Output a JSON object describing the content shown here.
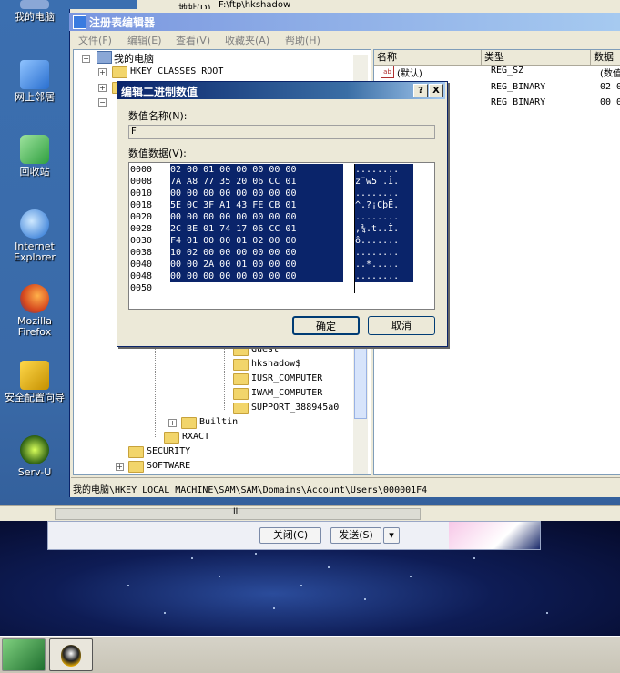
{
  "desktop": {
    "icons": [
      {
        "label": "我的电脑"
      },
      {
        "label": "网上邻居"
      },
      {
        "label": "回收站"
      },
      {
        "label": "Internet Explorer"
      },
      {
        "label": "Mozilla Firefox"
      },
      {
        "label": "安全配置向导"
      },
      {
        "label": "Serv-U"
      }
    ]
  },
  "background_window": {
    "address_label": "地址(D)",
    "address_value": "F:\\ftp\\hkshadow"
  },
  "regedit": {
    "title": "注册表编辑器",
    "menu": [
      "文件(F)",
      "编辑(E)",
      "查看(V)",
      "收藏夹(A)",
      "帮助(H)"
    ],
    "tree": {
      "root": "我的电脑",
      "top_items": [
        "HKEY_CLASSES_ROOT"
      ],
      "sub_items": [
        "Guest",
        "hkshadow$",
        "IUSR_COMPUTER",
        "IWAM_COMPUTER",
        "SUPPORT_388945a0"
      ],
      "builtin": "Builtin",
      "rxact": "RXACT",
      "security": "SECURITY",
      "software": "SOFTWARE"
    },
    "list": {
      "columns": [
        "名称",
        "类型",
        "数据"
      ],
      "rows": [
        {
          "name": "(默认)",
          "type": "REG_SZ",
          "data": "(数值"
        },
        {
          "name": "",
          "type": "REG_BINARY",
          "data": "02 0"
        },
        {
          "name": "",
          "type": "REG_BINARY",
          "data": "00 0"
        }
      ]
    },
    "status": "我的电脑\\HKEY_LOCAL_MACHINE\\SAM\\SAM\\Domains\\Account\\Users\\000001F4"
  },
  "dialog": {
    "title": "编辑二进制数值",
    "help_btn": "?",
    "close_btn": "X",
    "name_label": "数值名称(N):",
    "name_value": "F",
    "data_label": "数值数据(V):",
    "hex_rows": [
      {
        "addr": "0000",
        "bytes": "02 00 01 00 00 00 00 00",
        "ascii": "........"
      },
      {
        "addr": "0008",
        "bytes": "7A A8 77 35 20 06 CC 01",
        "ascii": "z¨w5 .Ì."
      },
      {
        "addr": "0010",
        "bytes": "00 00 00 00 00 00 00 00",
        "ascii": "........"
      },
      {
        "addr": "0018",
        "bytes": "5E 0C 3F A1 43 FE CB 01",
        "ascii": "^.?¡CþË."
      },
      {
        "addr": "0020",
        "bytes": "00 00 00 00 00 00 00 00",
        "ascii": "........"
      },
      {
        "addr": "0028",
        "bytes": "2C BE 01 74 17 06 CC 01",
        "ascii": ",¾.t..Ì."
      },
      {
        "addr": "0030",
        "bytes": "F4 01 00 00 01 02 00 00",
        "ascii": "ô......."
      },
      {
        "addr": "0038",
        "bytes": "10 02 00 00 00 00 00 00",
        "ascii": "........"
      },
      {
        "addr": "0040",
        "bytes": "00 00 2A 00 01 00 00 00",
        "ascii": "..*....."
      },
      {
        "addr": "0048",
        "bytes": "00 00 00 00 00 00 00 00",
        "ascii": "........"
      },
      {
        "addr": "0050",
        "bytes": "",
        "ascii": ""
      }
    ],
    "ok": "确定",
    "cancel": "取消"
  },
  "chat": {
    "close": "关闭(C)",
    "send": "发送(S)",
    "dropdown": "▾"
  },
  "colors": {
    "title_active": "#0a246a",
    "selection": "#0a246a",
    "face": "#ece9d8"
  }
}
